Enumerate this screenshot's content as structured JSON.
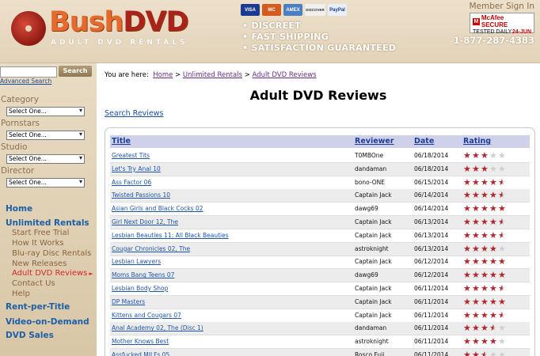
{
  "header": {
    "logo_bush": "Bush",
    "logo_dvd": "DVD",
    "logo_tagline": "ADULT DVD RENTALS",
    "payment_cards": [
      "VISA",
      "MC",
      "AMEX",
      "DISCOVER",
      "PayPal"
    ],
    "bullets": [
      "DISCREET",
      "FAST SHIPPING",
      "SATISFACTION GUARANTEED"
    ],
    "member_sign_in": "Member Sign In",
    "mcafee_title": "McAfee SECURE",
    "mcafee_tested": "TESTED DAILY",
    "mcafee_date": "24-JUN",
    "phone": "1-877-287-4383"
  },
  "sidebar": {
    "search_button": "Search",
    "advanced_search": "Advanced Search",
    "filters": [
      {
        "label": "Category",
        "value": "Select One..."
      },
      {
        "label": "Pornstars",
        "value": "Select One..."
      },
      {
        "label": "Studio",
        "value": "Select One..."
      },
      {
        "label": "Director",
        "value": "Select One..."
      }
    ],
    "home": "Home",
    "unlimited_rentals": "Unlimited Rentals",
    "sub_items": [
      "Start Free Trial",
      "How It Works",
      "Blu-ray Disc Rentals",
      "New Releases",
      "Adult DVD Reviews",
      "Contact Us",
      "Help"
    ],
    "active_sub": "Adult DVD Reviews",
    "rent_per_title": "Rent-per-Title",
    "video_on_demand": "Video-on-Demand",
    "dvd_sales": "DVD Sales"
  },
  "main": {
    "breadcrumb_prefix": "You are here:",
    "breadcrumb": [
      "Home",
      "Unlimited Rentals",
      "Adult DVD Reviews"
    ],
    "breadcrumb_sep": ">",
    "page_title": "Adult DVD Reviews",
    "search_reviews": "Search Reviews",
    "columns": [
      "Title",
      "Reviewer",
      "Date",
      "Rating"
    ],
    "rows": [
      {
        "title": "Greatest Tits",
        "reviewer": "T0MBOne",
        "date": "06/18/2014",
        "rating": 3
      },
      {
        "title": "Let's Try Anal 10",
        "reviewer": "dandaman",
        "date": "06/18/2014",
        "rating": 3
      },
      {
        "title": "Ass Factor 06",
        "reviewer": "bono-ONE",
        "date": "06/15/2014",
        "rating": 4.5
      },
      {
        "title": "Twisted Passions 10",
        "reviewer": "Captain Jack",
        "date": "06/14/2014",
        "rating": 4.5
      },
      {
        "title": "Asian Girls and Black Cocks 02",
        "reviewer": "dawg69",
        "date": "06/14/2014",
        "rating": 5
      },
      {
        "title": "Girl Next Door 12, The",
        "reviewer": "Captain Jack",
        "date": "06/13/2014",
        "rating": 4.5
      },
      {
        "title": "Lesbian Beauties 11: All Black Beauties",
        "reviewer": "Captain Jack",
        "date": "06/13/2014",
        "rating": 4.5
      },
      {
        "title": "Cougar Chronicles 02, The",
        "reviewer": "astroknight",
        "date": "06/13/2014",
        "rating": 4
      },
      {
        "title": "Lesbian Lawyers",
        "reviewer": "Captain Jack",
        "date": "06/12/2014",
        "rating": 5
      },
      {
        "title": "Moms Bang Teens 07",
        "reviewer": "dawg69",
        "date": "06/12/2014",
        "rating": 5
      },
      {
        "title": "Lesbian Body Shop",
        "reviewer": "Captain Jack",
        "date": "06/11/2014",
        "rating": 4.5
      },
      {
        "title": "DP Masters",
        "reviewer": "Captain Jack",
        "date": "06/11/2014",
        "rating": 5
      },
      {
        "title": "Kittens and Cougars 07",
        "reviewer": "Captain Jack",
        "date": "06/11/2014",
        "rating": 4.5
      },
      {
        "title": "Anal Academy 02, The (Disc 1)",
        "reviewer": "dandaman",
        "date": "06/11/2014",
        "rating": 3.5
      },
      {
        "title": "Mother Knows Best",
        "reviewer": "astroknight",
        "date": "06/11/2014",
        "rating": 4
      },
      {
        "title": "Assfucked MILFs 05",
        "reviewer": "Rosco Fuji",
        "date": "06/11/2014",
        "rating": 2.5
      }
    ]
  },
  "colors": {
    "accent": "#b3262b",
    "link": "#1d55a8",
    "header_bg": "#cfd1ea"
  }
}
